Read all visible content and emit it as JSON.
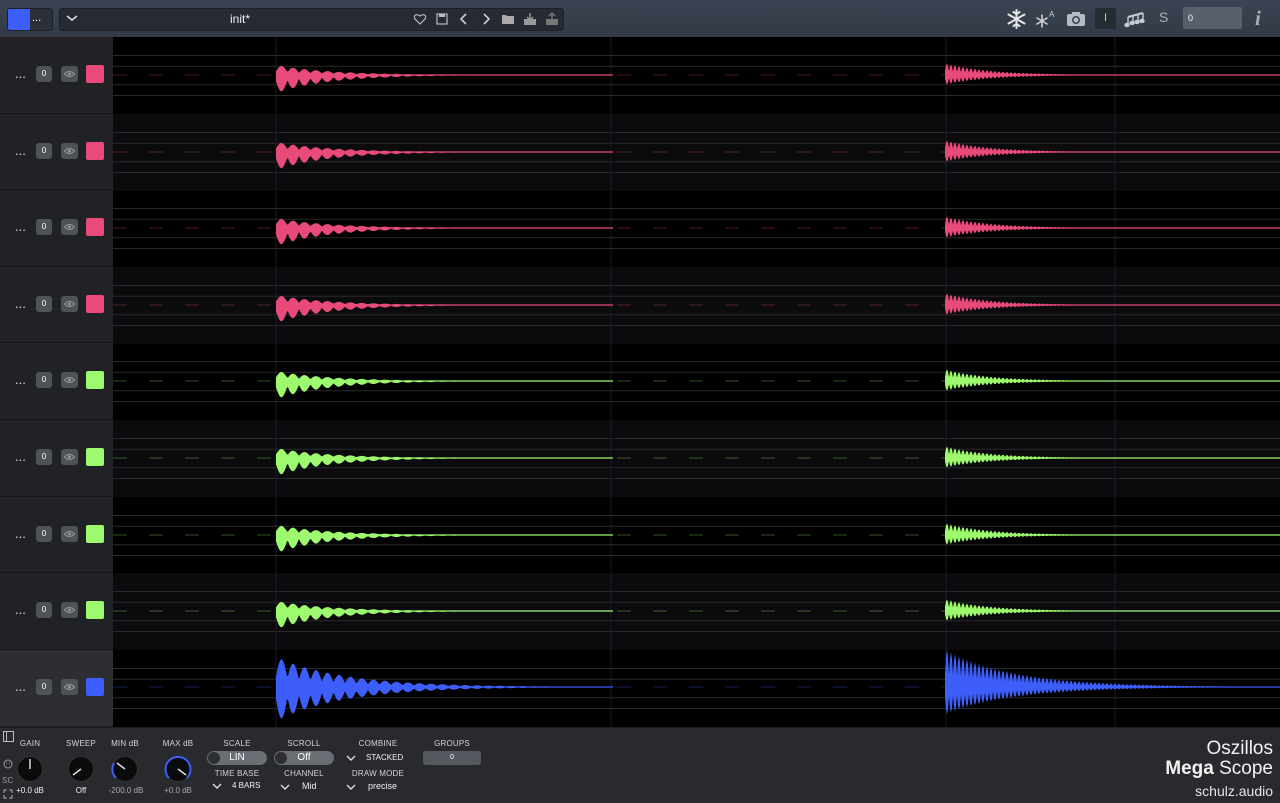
{
  "header": {
    "color_menu_label": "...",
    "preset_name": "init*",
    "offset_value": "0",
    "s_label": "S",
    "i_label": "I",
    "info_label": "i",
    "icons": [
      "chevron-down-icon",
      "heart-icon",
      "save-icon",
      "chevron-left-icon",
      "chevron-right-icon",
      "folder-icon",
      "import-icon",
      "export-icon",
      "snowflake-icon",
      "auto-freeze-icon",
      "camera-icon",
      "notes-icon"
    ]
  },
  "tracks": [
    {
      "more": "...",
      "offset": "0",
      "color": "#e84a7a"
    },
    {
      "more": "...",
      "offset": "0",
      "color": "#e84a7a"
    },
    {
      "more": "...",
      "offset": "0",
      "color": "#e84a7a"
    },
    {
      "more": "...",
      "offset": "0",
      "color": "#e84a7a"
    },
    {
      "more": "...",
      "offset": "0",
      "color": "#9dfa6e"
    },
    {
      "more": "...",
      "offset": "0",
      "color": "#9dfa6e"
    },
    {
      "more": "...",
      "offset": "0",
      "color": "#9dfa6e"
    },
    {
      "more": "...",
      "offset": "0",
      "color": "#9dfa6e"
    },
    {
      "more": "...",
      "offset": "0",
      "color": "#3d5efa",
      "selected": true
    }
  ],
  "controls": {
    "gain": {
      "label": "GAIN",
      "value": "+0.0 dB"
    },
    "sweep": {
      "label": "SWEEP",
      "value": "Off"
    },
    "min_db": {
      "label": "MIN dB",
      "value": "-200.0 dB"
    },
    "max_db": {
      "label": "MAX dB",
      "value": "+0.0 dB"
    },
    "scale": {
      "label": "SCALE",
      "value": "LIN"
    },
    "scroll": {
      "label": "SCROLL",
      "value": "Off"
    },
    "combine": {
      "label": "COMBINE",
      "value": "STACKED"
    },
    "groups": {
      "label": "GROUPS",
      "value": "0"
    },
    "time_base": {
      "label": "TIME BASE",
      "value": "4 BARS"
    },
    "channel": {
      "label": "CHANNEL",
      "value": "Mid"
    },
    "draw_mode": {
      "label": "DRAW MODE",
      "value": "precise"
    },
    "sc_label": "SC"
  },
  "brand": {
    "line1": "Oszillos",
    "line2_bold": "Mega",
    "line2_rest": " Scope",
    "line3": "schulz.audio"
  },
  "colors": {
    "accent": "#3d5efa",
    "pink": "#e84a7a",
    "green": "#9dfa6e"
  }
}
